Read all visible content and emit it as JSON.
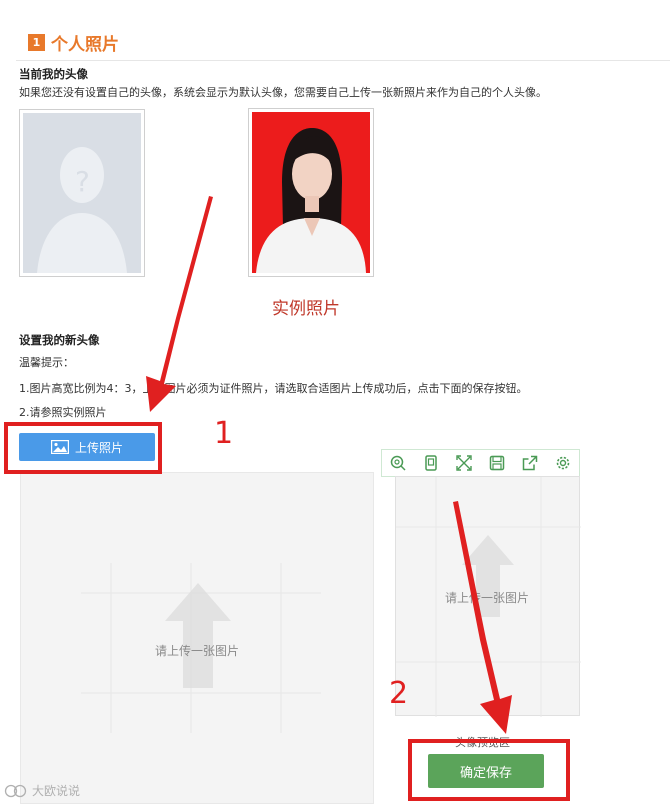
{
  "section": {
    "number": "1",
    "title": "个人照片"
  },
  "current_avatar": {
    "heading": "当前我的头像",
    "description": "如果您还没有设置自己的头像，系统会显示为默认头像，您需要自己上传一张新照片来作为自己的个人头像。"
  },
  "example_caption": "实例照片",
  "new_avatar": {
    "heading": "设置我的新头像",
    "tips_label": "温馨提示：",
    "tip1": "1.图片高宽比例为4：3，上传图片必须为证件照片，请选取合适图片上传成功后，点击下面的保存按钮。",
    "tip2": "2.请参照实例照片"
  },
  "upload_button": "上传照片",
  "crop_placeholder": "请上传一张图片",
  "preview_placeholder": "请上传一张图片",
  "preview_caption": "头像预览区",
  "save_button": "确定保存",
  "annotations": {
    "step1": "1",
    "step2": "2"
  },
  "watermark": "大欧说说",
  "toolbar_icons": [
    "zoom-icon",
    "crop-icon",
    "fullscreen-icon",
    "save-icon",
    "share-icon",
    "settings-icon"
  ],
  "colors": {
    "accent_orange": "#e8792b",
    "upload_blue": "#4a9ae8",
    "save_green": "#5ba45a",
    "annotation_red": "#e02020",
    "photo_background": "#ec1c1c"
  }
}
